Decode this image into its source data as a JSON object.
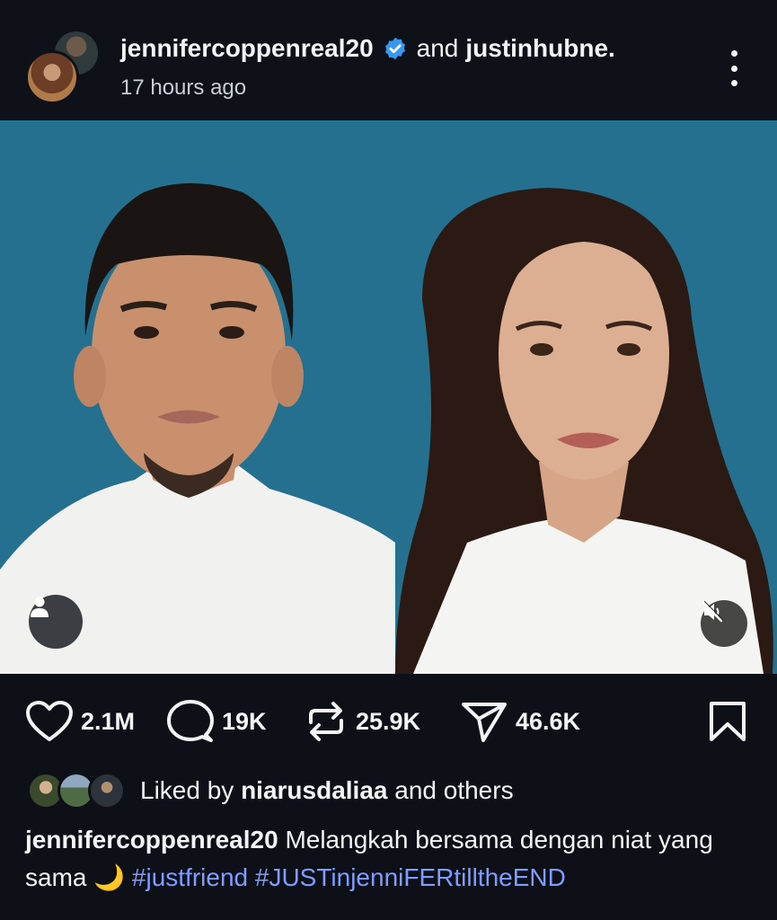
{
  "header": {
    "username": "jennifercoppenreal20",
    "and_text": "and",
    "coauthor": "justinhubne.",
    "time": "17 hours ago"
  },
  "stats": {
    "likes": "2.1M",
    "comments": "19K",
    "reposts": "25.9K",
    "shares": "46.6K"
  },
  "liked_by": {
    "prefix": "Liked by",
    "user": "niarusdaliaa",
    "suffix": "and others"
  },
  "caption": {
    "username": "jennifercoppenreal20",
    "text": "Melangkah bersama dengan niat yang sama",
    "emoji": "🌙",
    "tags": [
      "#justfriend",
      "#JUSTinjenniFERtilltheEND"
    ]
  },
  "colors": {
    "background": "#0d1117",
    "photo_background": "#25708f",
    "hashtag": "#7f9dff",
    "verified": "#3897f0"
  },
  "icons": [
    "more-options-icon",
    "verified-badge-icon",
    "person-tag-icon",
    "muted-speaker-icon",
    "heart-icon",
    "comment-icon",
    "repost-icon",
    "share-icon",
    "bookmark-icon"
  ]
}
